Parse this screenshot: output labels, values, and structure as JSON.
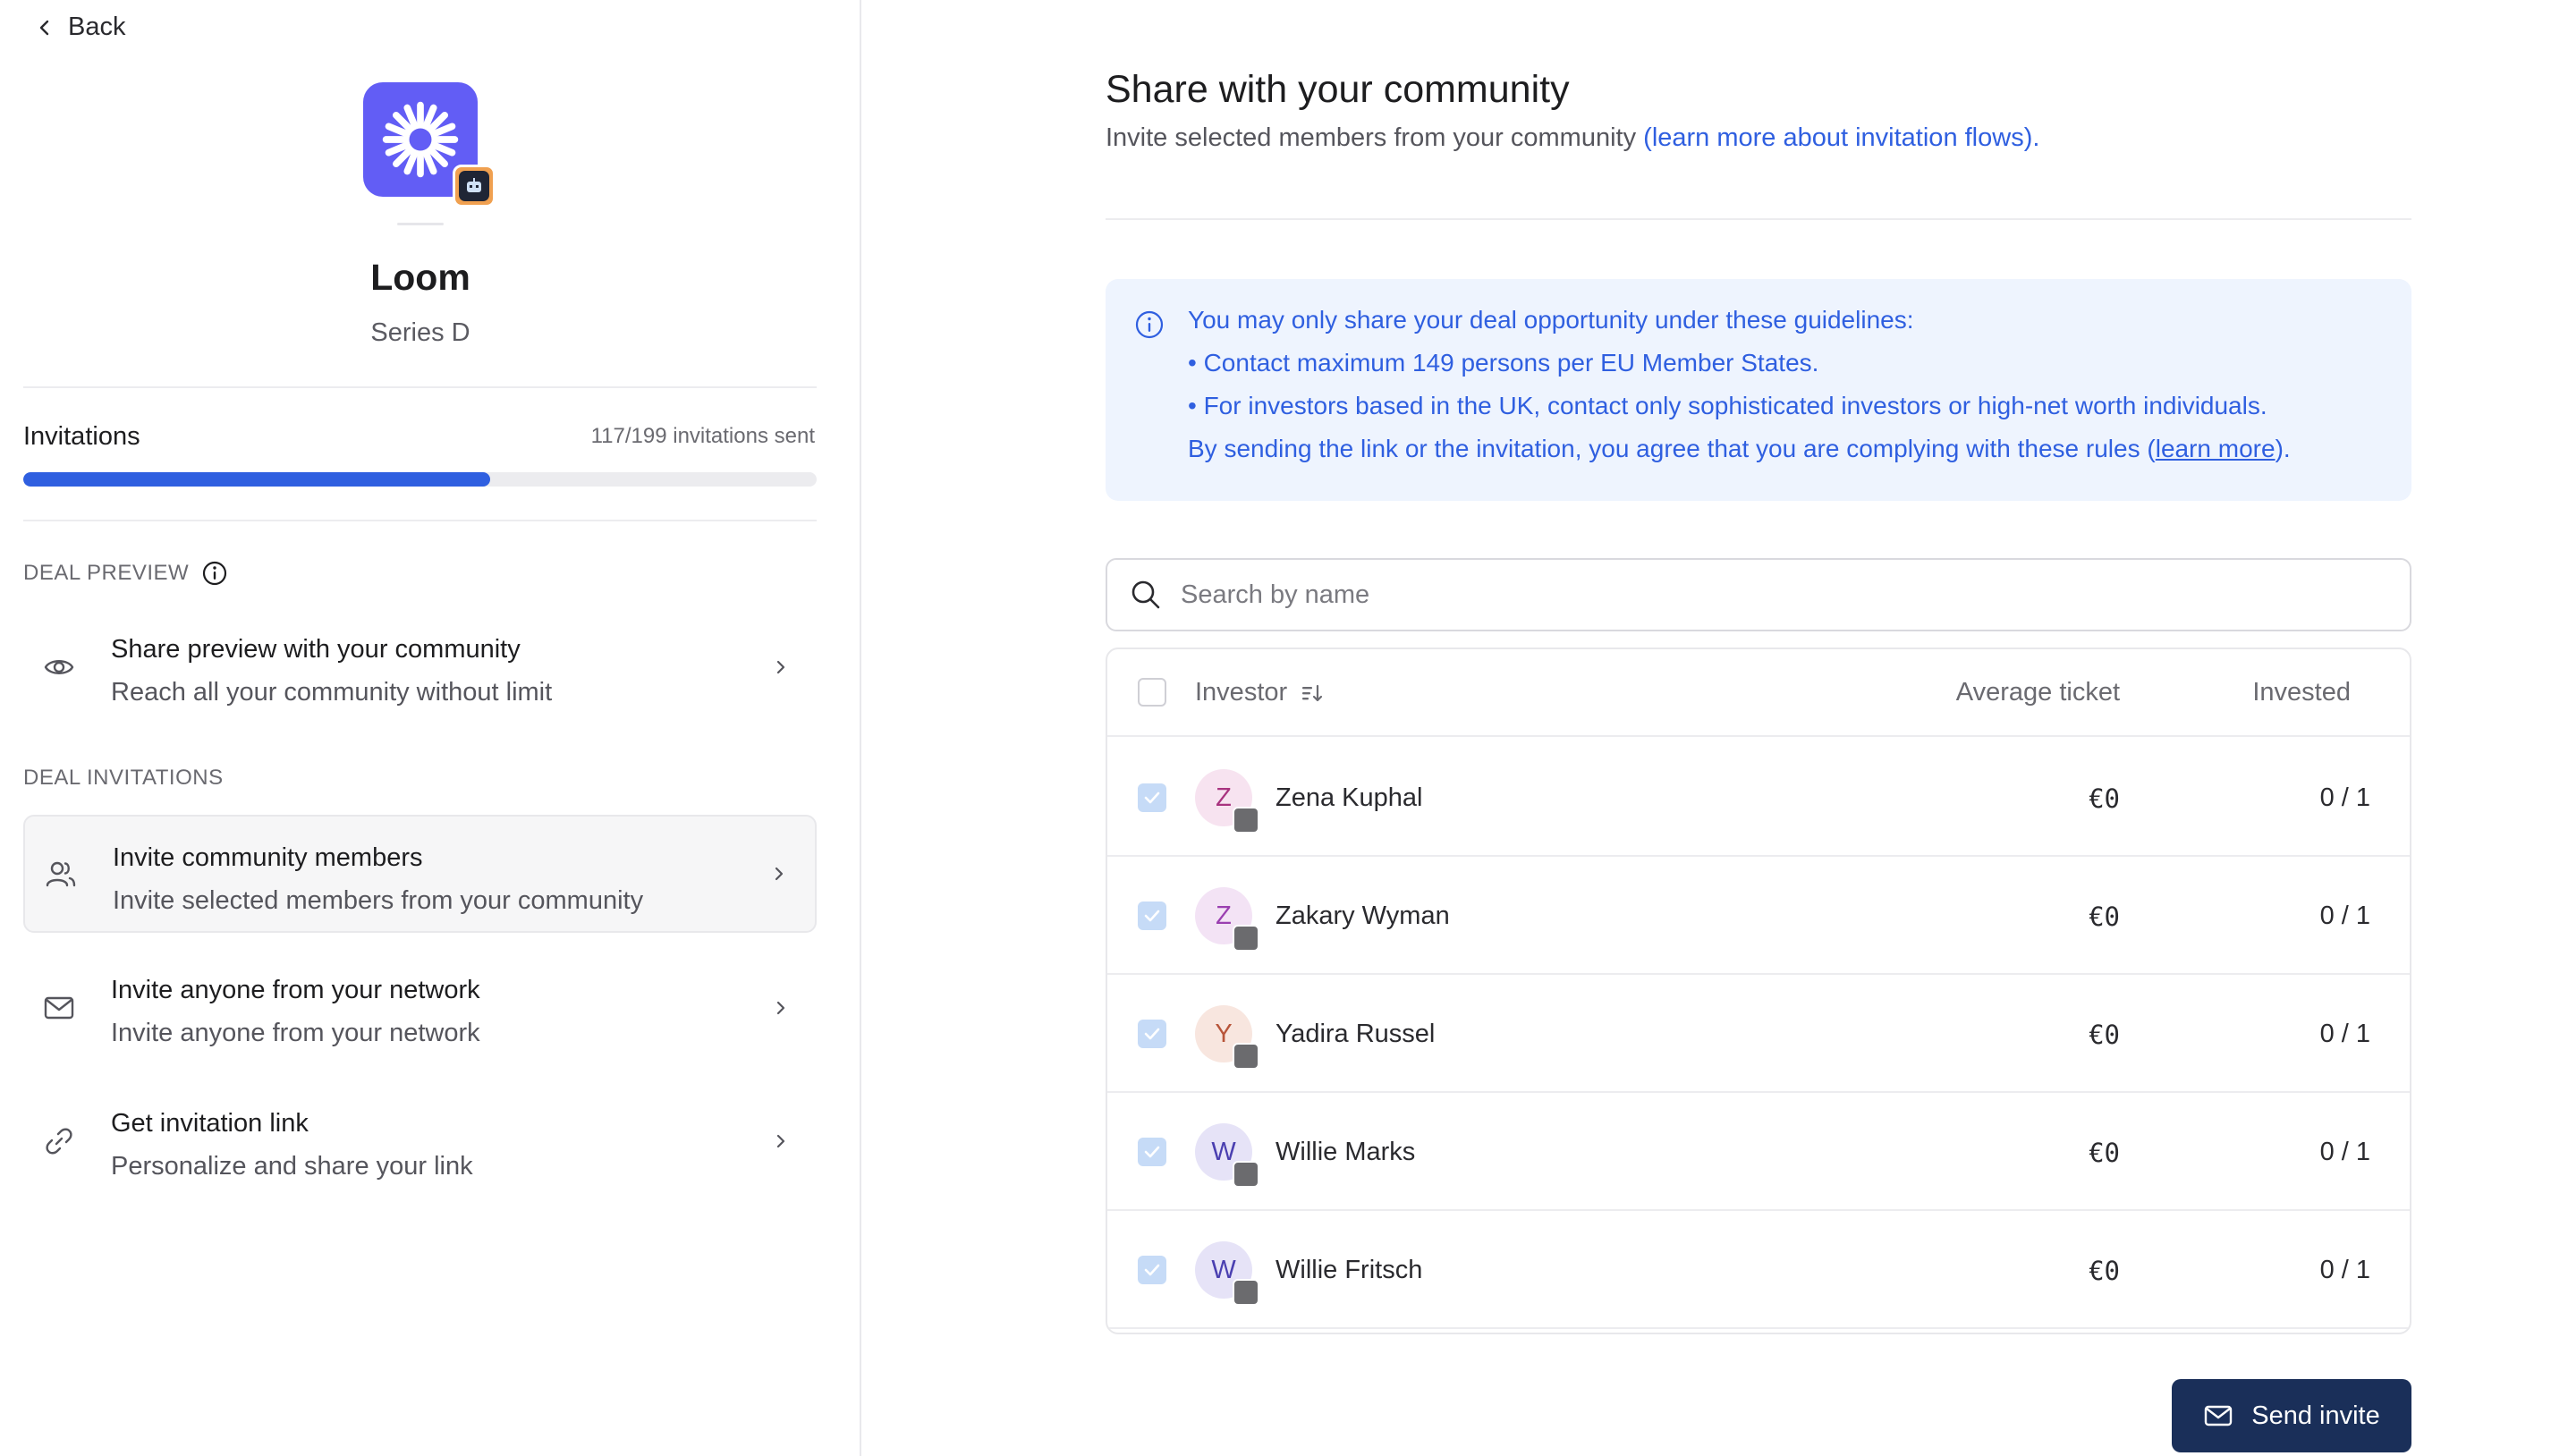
{
  "nav": {
    "back_label": "Back"
  },
  "company": {
    "name": "Loom",
    "round": "Series D",
    "brand_color": "#625df5"
  },
  "invitations": {
    "label": "Invitations",
    "count_text": "117/199 invitations sent",
    "sent": 117,
    "total": 199,
    "progress_color": "#2f5fe0"
  },
  "deal_preview": {
    "section_title": "DEAL PREVIEW",
    "item": {
      "title": "Share preview with your community",
      "subtitle": "Reach all your community without limit",
      "icon": "eye-icon"
    }
  },
  "deal_invitations": {
    "section_title": "DEAL INVITATIONS",
    "items": [
      {
        "title": "Invite community members",
        "subtitle": "Invite selected members from your community",
        "icon": "users-icon",
        "active": true
      },
      {
        "title": "Invite anyone from your network",
        "subtitle": "Invite anyone from your network",
        "icon": "mail-icon",
        "active": false
      },
      {
        "title": "Get invitation link",
        "subtitle": "Personalize and share your link",
        "icon": "link-icon",
        "active": false
      }
    ]
  },
  "main": {
    "title": "Share with your community",
    "subtitle": "Invite selected members from your community",
    "subtitle_link": "(learn more about invitation flows).",
    "notice": {
      "line1": "You may only share your deal opportunity under these guidelines:",
      "bullet1": "• Contact maximum 149 persons per EU Member States.",
      "bullet2": "• For investors based in the UK, contact only sophisticated investors or high-net worth individuals.",
      "line4_prefix": "By sending the link or the invitation, you agree that you are complying with these rules (",
      "line4_link": "learn more",
      "line4_suffix": ")."
    },
    "search": {
      "placeholder": "Search by name",
      "value": ""
    },
    "table": {
      "columns": {
        "investor": "Investor",
        "ticket": "Average ticket",
        "invested": "Invested"
      },
      "rows": [
        {
          "initial": "Z",
          "name": "Zena Kuphal",
          "ticket": "€0",
          "invested": "0 / 1",
          "checked": true,
          "avatar_bg": "#f7e3f0",
          "avatar_fg": "#a8337f"
        },
        {
          "initial": "Z",
          "name": "Zakary Wyman",
          "ticket": "€0",
          "invested": "0 / 1",
          "checked": true,
          "avatar_bg": "#f3e3f5",
          "avatar_fg": "#9a3fb0"
        },
        {
          "initial": "Y",
          "name": "Yadira Russel",
          "ticket": "€0",
          "invested": "0 / 1",
          "checked": true,
          "avatar_bg": "#f8e6df",
          "avatar_fg": "#b8553a"
        },
        {
          "initial": "W",
          "name": "Willie Marks",
          "ticket": "€0",
          "invested": "0 / 1",
          "checked": true,
          "avatar_bg": "#e6e3f7",
          "avatar_fg": "#4a3fb0"
        },
        {
          "initial": "W",
          "name": "Willie Fritsch",
          "ticket": "€0",
          "invested": "0 / 1",
          "checked": true,
          "avatar_bg": "#e6e3f7",
          "avatar_fg": "#4a3fb0"
        }
      ]
    },
    "send_button": {
      "label": "Send invite",
      "color": "#1a2f59"
    }
  }
}
